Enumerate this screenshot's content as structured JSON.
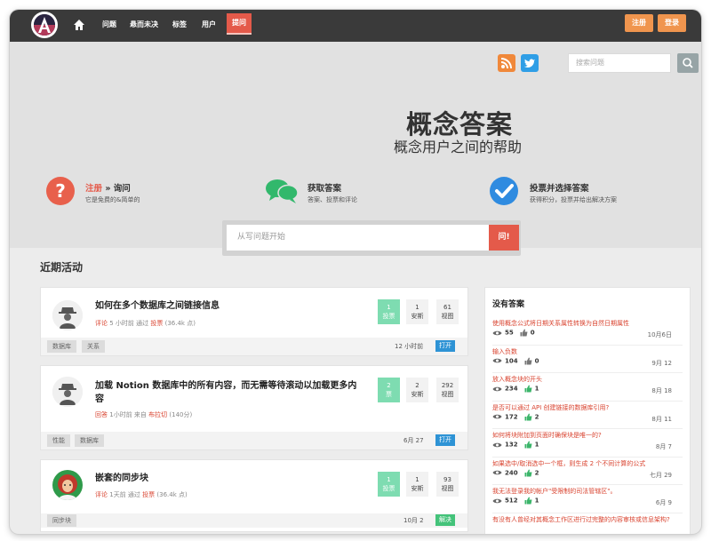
{
  "nav": {
    "links": [
      "问题",
      "悬而未决",
      "标签",
      "用户"
    ],
    "ask": "提问",
    "register": "注册",
    "login": "登录"
  },
  "search": {
    "placeholder": "搜索问题"
  },
  "hero": {
    "title": "概念答案",
    "subtitle": "概念用户之间的帮助",
    "features": [
      {
        "prefix": "注册",
        "title": " » 询问",
        "desc": "它是免费的&简单的"
      },
      {
        "title": "获取答案",
        "desc": "答案、投票和评论"
      },
      {
        "title": "投票并选择答案",
        "desc": "获得积分，投票并给出解决方案"
      }
    ],
    "ask_placeholder": "从写问题开始",
    "ask_button": "问!"
  },
  "recent": {
    "title": "近期活动",
    "questions": [
      {
        "title": "如何在多个数据库之间链接信息",
        "meta": {
          "action": "评论",
          "time": "5 小时前 通过",
          "user": "投票",
          "points": "(36.4k 点)"
        },
        "stats": [
          {
            "num": "1",
            "label": "投票"
          },
          {
            "num": "1",
            "label": "安斯"
          },
          {
            "num": "61",
            "label": "视图"
          }
        ],
        "tags": [
          "数据库",
          "关系"
        ],
        "date": "12 小时前",
        "badge": "打开"
      },
      {
        "title_lines": [
          "加载 Notion 数据库中的所有内容，而无需等待滚动以加载更多内",
          "容"
        ],
        "meta": {
          "action": "回答",
          "time": "1小时前 来自",
          "user": "布拉切",
          "points": "(140分)"
        },
        "stats": [
          {
            "num": "2",
            "label": "票"
          },
          {
            "num": "2",
            "label": "安斯"
          },
          {
            "num": "292",
            "label": "视图"
          }
        ],
        "tags": [
          "性能",
          "数据库"
        ],
        "date": "6月 27",
        "badge": "打开"
      },
      {
        "title": "嵌套的同步块",
        "meta": {
          "action": "评论",
          "time": "1天前 通过",
          "user": "投票",
          "points": "(36.4k 点)"
        },
        "stats": [
          {
            "num": "1",
            "label": "投票"
          },
          {
            "num": "1",
            "label": "安斯"
          },
          {
            "num": "93",
            "label": "视图"
          }
        ],
        "tags": [
          "同步块"
        ],
        "date": "10月 2",
        "badge": "解决"
      }
    ]
  },
  "sidebar": {
    "title": "没有答案",
    "items": [
      {
        "title": "使用概念公式将日期关系属性转换为自然日期属性",
        "views": "55",
        "votes": "0",
        "date": "10月6日"
      },
      {
        "title": "输入负数",
        "views": "104",
        "votes": "0",
        "date": "9月 12"
      },
      {
        "title": "放入概念块的开头",
        "views": "234",
        "votes": "1",
        "date": "8月 18"
      },
      {
        "title": "是否可以通过 API 创建链接的数据库引用?",
        "views": "172",
        "votes": "2",
        "date": "8月 11"
      },
      {
        "title": "如何将块附加到页面时确保块是唯一的?",
        "views": "132",
        "votes": "1",
        "date": "8月 7"
      },
      {
        "title": "如果选中/取消选中一个框，则生成 2 个不同计算的公式",
        "views": "240",
        "votes": "2",
        "date": "七月 29"
      },
      {
        "title": "我无法登录我的帐户\"受限制的司法管辖区\"。",
        "views": "512",
        "votes": "1",
        "date": "6月 9"
      },
      {
        "title": "有没有人曾经对其概念工作区进行过完整的内容审核或信息架构?",
        "views": "",
        "votes": "",
        "date": ""
      }
    ]
  }
}
